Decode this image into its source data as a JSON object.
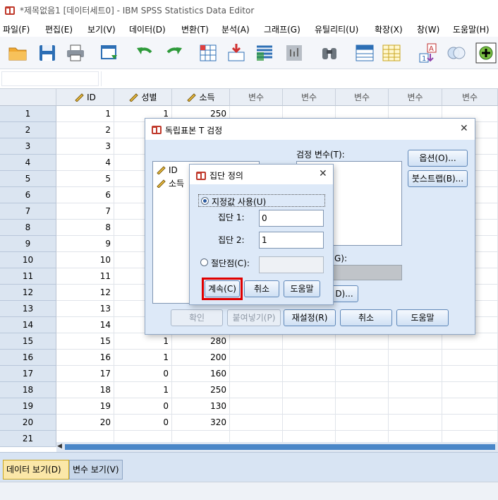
{
  "window": {
    "title": "*제목없음1 [데이터세트0] - IBM SPSS Statistics Data Editor"
  },
  "menu": [
    "파일(F)",
    "편집(E)",
    "보기(V)",
    "데이터(D)",
    "변환(T)",
    "분석(A)",
    "그래프(G)",
    "유틸리티(U)",
    "확장(X)",
    "창(W)",
    "도움말(H)"
  ],
  "toolbar": {
    "icons": [
      "open-folder-icon",
      "save-icon",
      "print-icon",
      "recall-dialog-icon",
      "undo-icon",
      "redo-icon",
      "goto-case-icon",
      "goto-variable-icon",
      "variables-icon",
      "run-descriptives-icon",
      "find-icon",
      "insert-cases-icon",
      "insert-variable-icon",
      "split-file-icon",
      "value-labels-icon",
      "use-sets-icon",
      "add-icon"
    ]
  },
  "grid": {
    "columns": [
      "ID",
      "성별",
      "소득",
      "변수",
      "변수",
      "변수",
      "변수",
      "변수"
    ],
    "rows": [
      {
        "n": "1",
        "id": "1",
        "sex": "1",
        "income": "250"
      },
      {
        "n": "2",
        "id": "2",
        "sex": "",
        "income": ""
      },
      {
        "n": "3",
        "id": "3",
        "sex": "",
        "income": ""
      },
      {
        "n": "4",
        "id": "4",
        "sex": "",
        "income": ""
      },
      {
        "n": "5",
        "id": "5",
        "sex": "",
        "income": ""
      },
      {
        "n": "6",
        "id": "6",
        "sex": "",
        "income": ""
      },
      {
        "n": "7",
        "id": "7",
        "sex": "",
        "income": ""
      },
      {
        "n": "8",
        "id": "8",
        "sex": "",
        "income": ""
      },
      {
        "n": "9",
        "id": "9",
        "sex": "",
        "income": ""
      },
      {
        "n": "10",
        "id": "10",
        "sex": "",
        "income": ""
      },
      {
        "n": "11",
        "id": "11",
        "sex": "",
        "income": ""
      },
      {
        "n": "12",
        "id": "12",
        "sex": "",
        "income": ""
      },
      {
        "n": "13",
        "id": "13",
        "sex": "",
        "income": ""
      },
      {
        "n": "14",
        "id": "14",
        "sex": "",
        "income": ""
      },
      {
        "n": "15",
        "id": "15",
        "sex": "1",
        "income": "280"
      },
      {
        "n": "16",
        "id": "16",
        "sex": "1",
        "income": "200"
      },
      {
        "n": "17",
        "id": "17",
        "sex": "0",
        "income": "160"
      },
      {
        "n": "18",
        "id": "18",
        "sex": "1",
        "income": "250"
      },
      {
        "n": "19",
        "id": "19",
        "sex": "0",
        "income": "130"
      },
      {
        "n": "20",
        "id": "20",
        "sex": "0",
        "income": "320"
      },
      {
        "n": "21",
        "id": "",
        "sex": "",
        "income": ""
      }
    ]
  },
  "tabs": {
    "data_view": "데이터 보기(D)",
    "variable_view": "변수 보기(V)"
  },
  "ttest_dialog": {
    "title": "독립표본 T 검정",
    "source_vars": [
      "ID",
      "소득"
    ],
    "test_var_label": "검정 변수(T):",
    "grouping_label_fragment": "G):",
    "define_groups_fragment": "D)...",
    "options_button": "옵션(O)...",
    "bootstrap_button": "붓스트랩(B)...",
    "ok_button": "확인",
    "paste_button": "붙여넣기(P)",
    "reset_button": "재설정(R)",
    "cancel_button": "취소",
    "help_button": "도움말"
  },
  "group_dialog": {
    "title": "집단 정의",
    "use_specified_label": "지정값 사용(U)",
    "group1_label": "집단 1:",
    "group1_value": "0",
    "group2_label": "집단 2:",
    "group2_value": "1",
    "cut_point_label": "절단점(C):",
    "cut_point_value": "",
    "continue_button": "계속(C)",
    "cancel_button": "취소",
    "help_button": "도움말"
  },
  "colors": {
    "highlight": "#e00000",
    "dialog_bg": "#dde9f8",
    "row_header": "#dbe5f1"
  }
}
